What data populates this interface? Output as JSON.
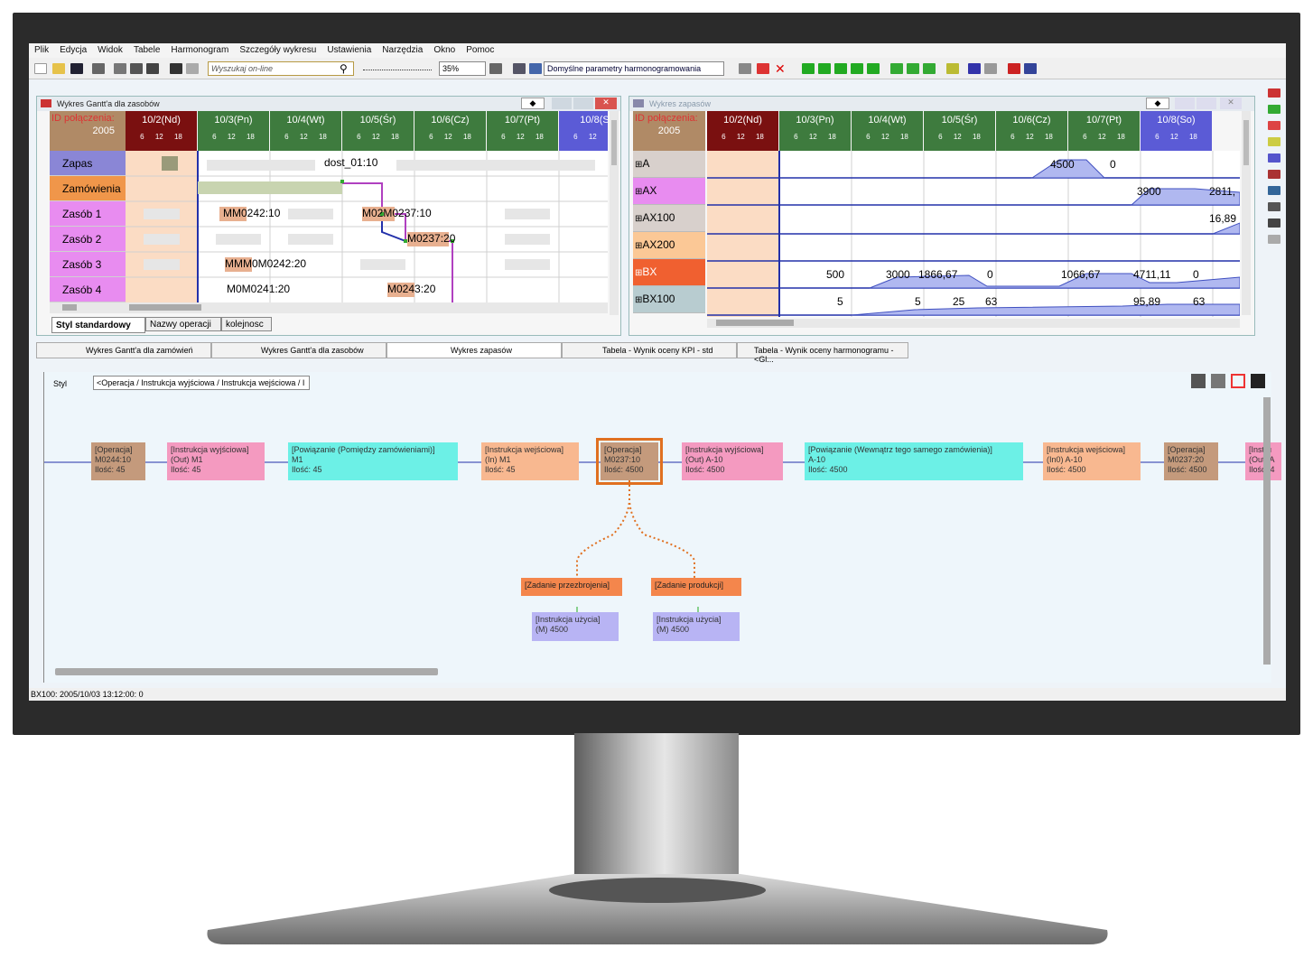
{
  "menu": [
    "Plik",
    "Edycja",
    "Widok",
    "Tabele",
    "Harmonogram",
    "Szczegóły wykresu",
    "Ustawienia",
    "Narzędzia",
    "Okno",
    "Pomoc"
  ],
  "toolbar": {
    "search_placeholder": "Wyszukaj on-line",
    "zoom": "35%",
    "params": "Domyślne parametry harmonogramowania"
  },
  "gantt": {
    "title": "Wykres Gantt'a dla zasobów",
    "header_label": "ID połączenia:",
    "year": "2005",
    "days": [
      "10/2(Nd)",
      "10/3(Pn)",
      "10/4(Wt)",
      "10/5(Śr)",
      "10/6(Cz)",
      "10/7(Pt)",
      "10/8(S"
    ],
    "ticks": [
      "6",
      "12",
      "18"
    ],
    "rows": [
      "Zapas",
      "Zamówienia",
      "Zasób 1",
      "Zasób 2",
      "Zasób 3",
      "Zasób 4"
    ],
    "bars": {
      "dost": "dost_01:10",
      "r1a": "MM0242:10",
      "r1b": "M02M0237:10",
      "r2": "M0237:20",
      "r3": "MMM0M0242:20",
      "r4a": "M0M0241:20",
      "r4b": "M0243:20"
    },
    "tabs": [
      "Styl standardowy",
      "Nazwy operacji",
      "kolejnosc"
    ]
  },
  "stock": {
    "title": "Wykres zapasów",
    "header_label": "ID połączenia:",
    "year": "2005",
    "days": [
      "10/2(Nd)",
      "10/3(Pn)",
      "10/4(Wt)",
      "10/5(Śr)",
      "10/6(Cz)",
      "10/7(Pt)",
      "10/8(So)"
    ],
    "rows": [
      "A",
      "AX",
      "AX100",
      "AX200",
      "BX",
      "BX100"
    ],
    "vals": {
      "a1": "4500",
      "a2": "0",
      "ax1": "3900",
      "ax2": "2811,",
      "ax100": "16,89",
      "bx1": "500",
      "bx2": "3000",
      "bx3": "1866,67",
      "bx4": "0",
      "bx5": "1066,67",
      "bx6": "4711,11",
      "bx7": "0",
      "b1": "5",
      "b2": "5",
      "b3": "25",
      "b4": "63",
      "b5": "95,89",
      "b6": "63"
    }
  },
  "doctabs": [
    "Wykres Gantt'a dla zamówień",
    "Wykres Gantt'a dla zasobów",
    "Wykres zapasów",
    "Tabela - Wynik oceny KPI - std",
    "Tabela - Wynik oceny harmonogramu - <Gl..."
  ],
  "flow": {
    "style_label": "Styl",
    "style_value": "<Operacja / Instrukcja wyjściowa / Instrukcja wejściowa / I",
    "nodes": [
      [
        "[Operacja]",
        "M0244:10",
        "Ilość: 45"
      ],
      [
        "[Instrukcja wyjściowa]",
        "(Out) M1",
        "Ilość: 45"
      ],
      [
        "[Powiązanie (Pomiędzy zamówieniami)]",
        "M1",
        "Ilość: 45"
      ],
      [
        "[Instrukcja wejściowa]",
        "(In) M1",
        "Ilość: 45"
      ],
      [
        "[Operacja]",
        "M0237:10",
        "Ilość: 4500"
      ],
      [
        "[Instrukcja wyjściowa]",
        "(Out) A-10",
        "Ilość: 4500"
      ],
      [
        "[Powiązanie (Wewnątrz tego samego zamówienia)]",
        "A-10",
        "Ilość: 4500"
      ],
      [
        "[Instrukcja wejściowa]",
        "(In0) A-10",
        "Ilość: 4500"
      ],
      [
        "[Operacja]",
        "M0237:20",
        "Ilość: 4500"
      ],
      [
        "[Instru",
        "(Out) A",
        "Ilość: 4"
      ]
    ],
    "sub": [
      "[Zadanie przezbrojenia]",
      "[Zadanie produkcji]"
    ],
    "use": [
      [
        "[Instrukcja użycia]",
        "(M) 4500"
      ],
      [
        "[Instrukcja użycia]",
        "(M) 4500"
      ]
    ]
  },
  "status": "BX100: 2005/10/03 13:12:00: 0",
  "colors": {
    "day_red": "#7a1010",
    "day_green": "#3e7b3e",
    "day_blue": "#5b5bd6",
    "zapas": "#8a86d6",
    "zamowienia": "#f0964a",
    "zasob": "#e88cf0"
  }
}
